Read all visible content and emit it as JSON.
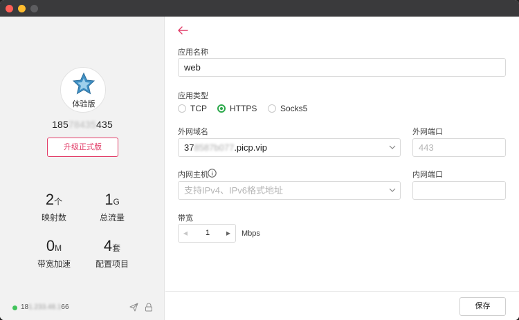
{
  "window": {
    "controls": [
      "close",
      "minimize",
      "disabled"
    ]
  },
  "sidebar": {
    "avatar_label": "体验版",
    "avatar_icon": "star-icon",
    "phone_prefix": "185",
    "phone_blurred": "78435",
    "phone_suffix": "435",
    "upgrade_label": "升级正式版",
    "stats": [
      {
        "num": "2",
        "unit": "个",
        "label": "映射数"
      },
      {
        "num": "1",
        "unit": "G",
        "label": "总流量"
      },
      {
        "num": "0",
        "unit": "M",
        "label": "带宽加速"
      },
      {
        "num": "4",
        "unit": "套",
        "label": "配置项目"
      }
    ],
    "status_color": "#41c35b",
    "ip_prefix": "18",
    "ip_blurred": "1.233.48.1",
    "ip_suffix": "66"
  },
  "form": {
    "app_name_label": "应用名称",
    "app_name_value": "web",
    "app_type_label": "应用类型",
    "app_type_options": [
      "TCP",
      "HTTPS",
      "Socks5"
    ],
    "app_type_selected": "HTTPS",
    "ext_domain_label": "外网域名",
    "ext_domain_prefix": "37",
    "ext_domain_blurred": "8587b077",
    "ext_domain_suffix": ".picp.vip",
    "ext_port_label": "外网端口",
    "ext_port_placeholder": "443",
    "int_host_label": "内网主机",
    "int_host_placeholder": "支持IPv4、IPv6格式地址",
    "int_port_label": "内网端口",
    "int_port_value": "",
    "bandwidth_label": "带宽",
    "bandwidth_value": "1",
    "bandwidth_unit": "Mbps"
  },
  "footer": {
    "save_label": "保存"
  },
  "colors": {
    "accent": "#e23d68",
    "radio_selected": "#2ba84a"
  }
}
